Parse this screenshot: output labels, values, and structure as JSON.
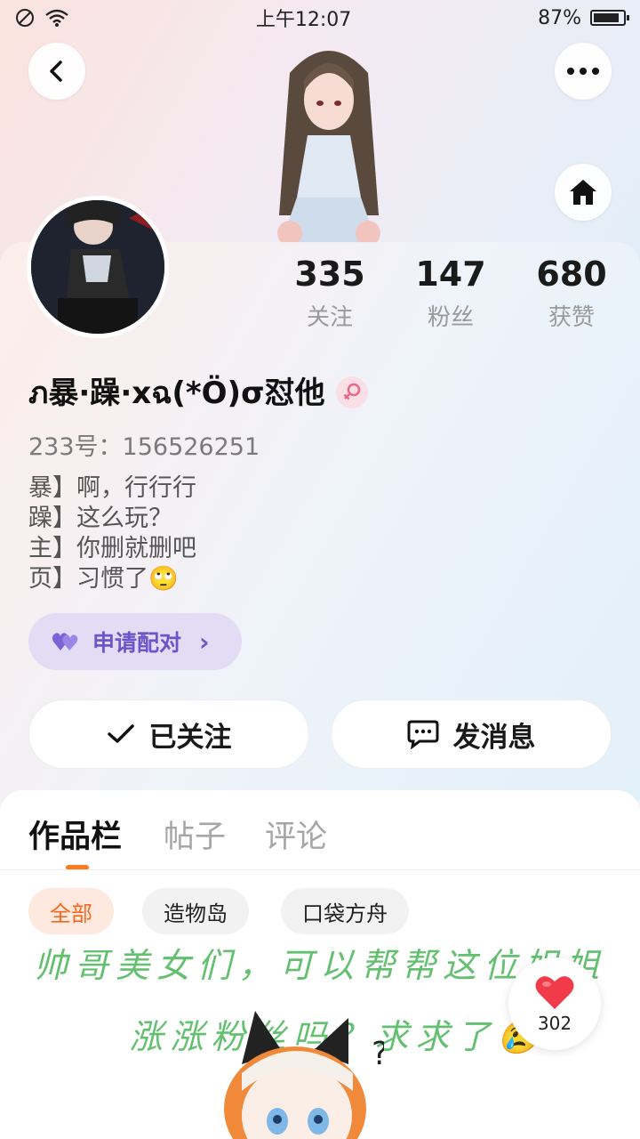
{
  "status_bar": {
    "time": "上午12:07",
    "battery_percent": "87%",
    "battery_level": 0.87
  },
  "stats": [
    {
      "value": "335",
      "label": "关注"
    },
    {
      "value": "147",
      "label": "粉丝"
    },
    {
      "value": "680",
      "label": "获赞"
    }
  ],
  "profile": {
    "username": "ภ暴·躁·xฉ(*Ö)σ怼他",
    "gender": "female",
    "id_text": "233号：156526251",
    "bio_lines": [
      "暴】啊，行行行",
      "躁】这么玩？",
      "主】你删就删吧",
      "页】习惯了🙄"
    ]
  },
  "pair_button": {
    "label": "申请配对",
    "chevron": "›"
  },
  "actions": {
    "follow_label": "已关注",
    "message_label": "发消息"
  },
  "tabs": [
    {
      "label": "作品栏",
      "active": true
    },
    {
      "label": "帖子",
      "active": false
    },
    {
      "label": "评论",
      "active": false
    }
  ],
  "filters": [
    {
      "label": "全部",
      "active": true
    },
    {
      "label": "造物岛",
      "active": false
    },
    {
      "label": "口袋方舟",
      "active": false
    }
  ],
  "overlay": {
    "line1": "帅哥美女们，可以帮帮这位姐姐",
    "line2": "涨涨粉丝吗？求求了😢"
  },
  "like": {
    "count": "302"
  },
  "colors": {
    "accent_orange": "#ff7a1a",
    "pair_purple": "#6b55c8",
    "overlay_green": "#62c06f"
  }
}
